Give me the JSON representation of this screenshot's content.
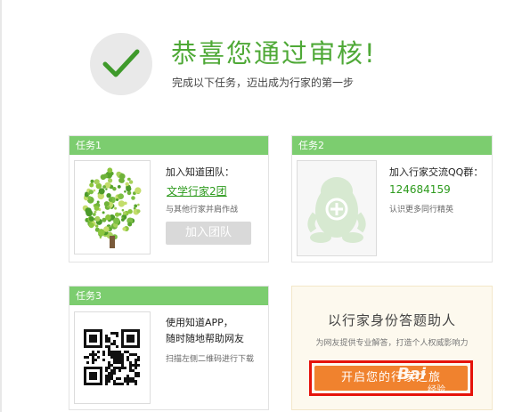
{
  "header": {
    "title": "恭喜您通过审核!",
    "subtitle": "完成以下任务，迈出成为行家的第一步"
  },
  "task1": {
    "heading": "任务1",
    "label": "加入知道团队：",
    "team_link": "文学行家2团",
    "desc": "与其他行家并肩作战",
    "button": "加入团队"
  },
  "task2": {
    "heading": "任务2",
    "label": "加入行家交流QQ群：",
    "qq_number": "124684159",
    "desc": "认识更多同行精英"
  },
  "task3": {
    "heading": "任务3",
    "line1": "使用知道APP，",
    "line2": "随时随地帮助网友",
    "desc": "扫描左侧二维码进行下载"
  },
  "promo": {
    "title": "以行家身份答题助人",
    "desc": "为网友提供专业解答，打造个人权威影响力",
    "button": "开启您的行家之旅"
  },
  "watermark": {
    "text": "Bai",
    "sub": "经验"
  },
  "colors": {
    "accent_green": "#7ccd6f",
    "title_green": "#4fa937",
    "cta_orange": "#f0822e",
    "highlight_red": "#e5130b"
  }
}
